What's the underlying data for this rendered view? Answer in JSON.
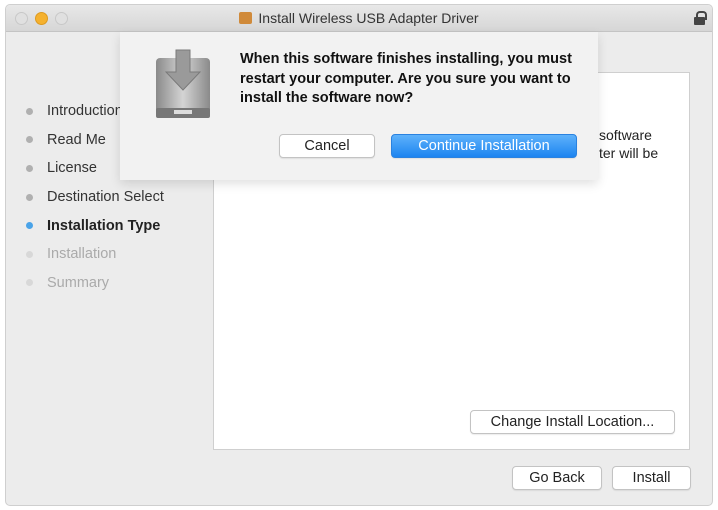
{
  "window": {
    "title": "Install Wireless USB Adapter Driver"
  },
  "steps": [
    {
      "label": "Introduction",
      "state": "done"
    },
    {
      "label": "Read Me",
      "state": "done"
    },
    {
      "label": "License",
      "state": "done"
    },
    {
      "label": "Destination Select",
      "state": "done"
    },
    {
      "label": "Installation Type",
      "state": "active"
    },
    {
      "label": "Installation",
      "state": "pending"
    },
    {
      "label": "Summary",
      "state": "pending"
    }
  ],
  "panel": {
    "text_line1": "software",
    "text_line2": "ter will be",
    "change_location_label": "Change Install Location..."
  },
  "footer": {
    "go_back_label": "Go Back",
    "install_label": "Install"
  },
  "dialog": {
    "message": "When this software finishes installing, you must restart your computer. Are you sure you want to install the software now?",
    "cancel_label": "Cancel",
    "continue_label": "Continue Installation"
  },
  "colors": {
    "accent": "#1c84f0"
  }
}
